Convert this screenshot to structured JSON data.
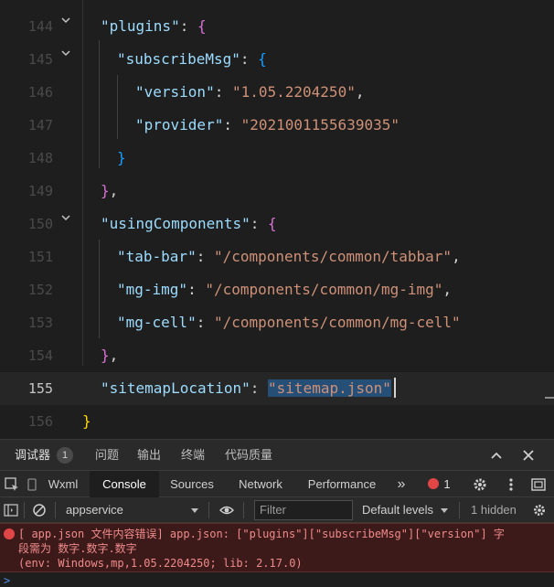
{
  "editor": {
    "top_partial": "},",
    "lines": [
      {
        "num": "144",
        "parts": [
          [
            "k",
            "\"plugins\""
          ],
          [
            "p",
            ": "
          ],
          [
            "b1",
            "{"
          ]
        ]
      },
      {
        "num": "145",
        "parts": [
          [
            "k",
            "\"subscribeMsg\""
          ],
          [
            "p",
            ": "
          ],
          [
            "b2",
            "{"
          ]
        ]
      },
      {
        "num": "146",
        "parts": [
          [
            "k",
            "\"version\""
          ],
          [
            "p",
            ": "
          ],
          [
            "s",
            "\"1.05.2204250\""
          ],
          [
            "p",
            ","
          ]
        ]
      },
      {
        "num": "147",
        "parts": [
          [
            "k",
            "\"provider\""
          ],
          [
            "p",
            ": "
          ],
          [
            "s",
            "\"2021001155639035\""
          ]
        ]
      },
      {
        "num": "148",
        "parts": [
          [
            "b2",
            "}"
          ]
        ]
      },
      {
        "num": "149",
        "parts": [
          [
            "b1",
            "}"
          ],
          [
            "p",
            ","
          ]
        ]
      },
      {
        "num": "150",
        "parts": [
          [
            "k",
            "\"usingComponents\""
          ],
          [
            "p",
            ": "
          ],
          [
            "b1",
            "{"
          ]
        ]
      },
      {
        "num": "151",
        "parts": [
          [
            "k",
            "\"tab-bar\""
          ],
          [
            "p",
            ": "
          ],
          [
            "s",
            "\"/components/common/tabbar\""
          ],
          [
            "p",
            ","
          ]
        ]
      },
      {
        "num": "152",
        "parts": [
          [
            "k",
            "\"mg-img\""
          ],
          [
            "p",
            ": "
          ],
          [
            "s",
            "\"/components/common/mg-img\""
          ],
          [
            "p",
            ","
          ]
        ]
      },
      {
        "num": "153",
        "parts": [
          [
            "k",
            "\"mg-cell\""
          ],
          [
            "p",
            ": "
          ],
          [
            "s",
            "\"/components/common/mg-cell\""
          ]
        ]
      },
      {
        "num": "154",
        "parts": [
          [
            "b1",
            "}"
          ],
          [
            "p",
            ","
          ]
        ]
      },
      {
        "num": "155",
        "parts": [
          [
            "k",
            "\"sitemapLocation\""
          ],
          [
            "p",
            ": "
          ],
          [
            "s",
            "\"sitemap.json\""
          ]
        ]
      },
      {
        "num": "156",
        "parts": [
          [
            "b0",
            "}"
          ]
        ]
      }
    ]
  },
  "panel": {
    "tabs": [
      "调试器",
      "问题",
      "输出",
      "终端",
      "代码质量"
    ],
    "debugger_badge": "1"
  },
  "devtools": {
    "tabs": [
      "Wxml",
      "Console",
      "Sources",
      "Network",
      "Performance"
    ],
    "active_tab": "Console",
    "more": "»",
    "error_count": "1"
  },
  "console_toolbar": {
    "context": "appservice",
    "filter_placeholder": "Filter",
    "levels": "Default levels",
    "hidden": "1 hidden"
  },
  "console": {
    "error_line1": "[ app.json 文件内容错误] app.json: [\"plugins\"][\"subscribeMsg\"][\"version\"] 字",
    "error_line2": "段需为 数字.数字.数字",
    "error_line3": "(env: Windows,mp,1.05.2204250; lib: 2.17.0)",
    "prompt": ">"
  },
  "colors": {
    "background": "#1e1e1e",
    "key": "#9cdcfe",
    "string": "#ce9178",
    "error_bg": "#3d1a1a",
    "error_text": "#f08a8a"
  }
}
